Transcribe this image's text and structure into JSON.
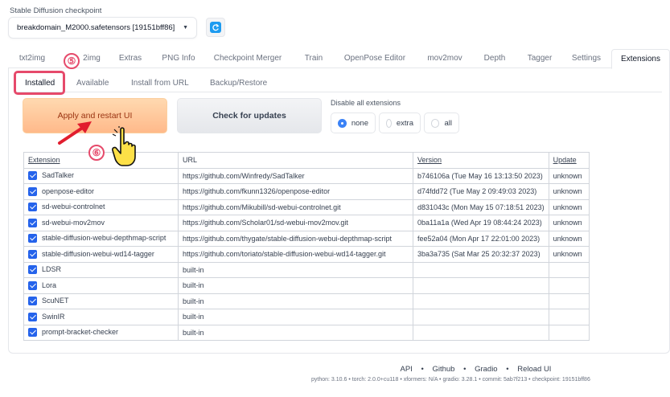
{
  "checkpoint": {
    "label": "Stable Diffusion checkpoint",
    "value": "breakdomain_M2000.safetensors [19151bff86]"
  },
  "top_tabs": [
    "txt2img",
    "img2img",
    "Extras",
    "PNG Info",
    "Checkpoint Merger",
    "Train",
    "OpenPose Editor",
    "mov2mov",
    "Depth",
    "Tagger",
    "Settings",
    "Extensions"
  ],
  "top_tab_img2img_partial": "2img",
  "active_top_tab": "Extensions",
  "sub_tabs": [
    "Installed",
    "Available",
    "Install from URL",
    "Backup/Restore"
  ],
  "active_sub_tab": "Installed",
  "buttons": {
    "apply": "Apply and restart UI",
    "check": "Check for updates"
  },
  "disable": {
    "label": "Disable all extensions",
    "options": [
      "none",
      "extra",
      "all"
    ],
    "selected": "none"
  },
  "table": {
    "headers": [
      "Extension",
      "URL",
      "Version",
      "Update"
    ],
    "rows": [
      {
        "name": "SadTalker",
        "url": "https://github.com/Winfredy/SadTalker",
        "version": "b746106a (Tue May 16 13:13:50 2023)",
        "update": "unknown"
      },
      {
        "name": "openpose-editor",
        "url": "https://github.com/fkunn1326/openpose-editor",
        "version": "d74fdd72 (Tue May 2 09:49:03 2023)",
        "update": "unknown"
      },
      {
        "name": "sd-webui-controlnet",
        "url": "https://github.com/Mikubill/sd-webui-controlnet.git",
        "version": "d831043c (Mon May 15 07:18:51 2023)",
        "update": "unknown"
      },
      {
        "name": "sd-webui-mov2mov",
        "url": "https://github.com/Scholar01/sd-webui-mov2mov.git",
        "version": "0ba11a1a (Wed Apr 19 08:44:24 2023)",
        "update": "unknown"
      },
      {
        "name": "stable-diffusion-webui-depthmap-script",
        "url": "https://github.com/thygate/stable-diffusion-webui-depthmap-script",
        "version": "fee52a04 (Mon Apr 17 22:01:00 2023)",
        "update": "unknown"
      },
      {
        "name": "stable-diffusion-webui-wd14-tagger",
        "url": "https://github.com/toriato/stable-diffusion-webui-wd14-tagger.git",
        "version": "3ba3a735 (Sat Mar 25 20:32:37 2023)",
        "update": "unknown"
      },
      {
        "name": "LDSR",
        "url": "built-in",
        "version": "",
        "update": ""
      },
      {
        "name": "Lora",
        "url": "built-in",
        "version": "",
        "update": ""
      },
      {
        "name": "ScuNET",
        "url": "built-in",
        "version": "",
        "update": ""
      },
      {
        "name": "SwinIR",
        "url": "built-in",
        "version": "",
        "update": ""
      },
      {
        "name": "prompt-bracket-checker",
        "url": "built-in",
        "version": "",
        "update": ""
      }
    ]
  },
  "annotations": {
    "step5": "⑤",
    "step6": "⑥"
  },
  "footer": {
    "links": [
      "API",
      "Github",
      "Gradio",
      "Reload UI"
    ],
    "separator": "•",
    "info": "python: 3.10.6  •  torch: 2.0.0+cu118  •  xformers: N/A  •  gradio: 3.28.1  •  commit: 5ab7f213  •  checkpoint: 19151bff86"
  },
  "colors": {
    "highlight": "#e64a6b",
    "primary": "#2563eb",
    "apply_gradient_top": "#ffd9b0"
  },
  "icons": {
    "refresh": "refresh-icon",
    "caret": "caret-down-icon",
    "hand": "pointing-hand-icon",
    "arrow": "red-arrow-icon"
  }
}
